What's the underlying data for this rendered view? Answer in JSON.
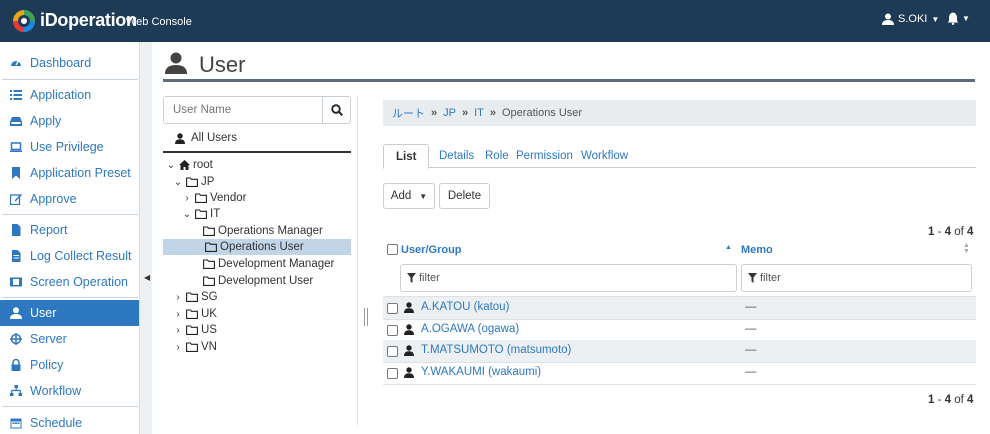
{
  "app": {
    "brand": "iDoperation",
    "brand_sub": "Web Console",
    "username": "S.OKI",
    "colors": {
      "topbar": "#1d3a57",
      "accent": "#2d78c0",
      "selected_tree": "#c2d5e8"
    }
  },
  "sidebar": {
    "items": [
      {
        "label": "Dashboard",
        "icon": "tachometer-icon"
      },
      {
        "label": "Application",
        "icon": "list-icon"
      },
      {
        "label": "Apply",
        "icon": "inbox-icon"
      },
      {
        "label": "Use Privilege",
        "icon": "laptop-icon"
      },
      {
        "label": "Application Preset",
        "icon": "bookmark-icon"
      },
      {
        "label": "Approve",
        "icon": "edit-icon"
      },
      {
        "label": "Report",
        "icon": "file-icon"
      },
      {
        "label": "Log Collect Result",
        "icon": "file-text-icon"
      },
      {
        "label": "Screen Operation",
        "icon": "film-icon"
      },
      {
        "label": "User",
        "icon": "user-icon",
        "active": true
      },
      {
        "label": "Server",
        "icon": "crosshair-icon"
      },
      {
        "label": "Policy",
        "icon": "lock-icon"
      },
      {
        "label": "Workflow",
        "icon": "sitemap-icon"
      },
      {
        "label": "Schedule",
        "icon": "calendar-icon"
      }
    ]
  },
  "page": {
    "title": "User"
  },
  "tree": {
    "search_placeholder": "User Name",
    "all_users": "All Users",
    "nodes": [
      {
        "label": "root",
        "toggle": "v",
        "icon": "home-icon"
      },
      {
        "label": "JP",
        "toggle": "v",
        "icon": "folder-icon"
      },
      {
        "label": "Vendor",
        "toggle": ">",
        "icon": "folder-icon"
      },
      {
        "label": "IT",
        "toggle": "v",
        "icon": "folder-icon"
      },
      {
        "label": "Operations Manager",
        "toggle": "",
        "icon": "folder-icon"
      },
      {
        "label": "Operations User",
        "toggle": "",
        "icon": "folder-icon",
        "selected": true
      },
      {
        "label": "Development Manager",
        "toggle": "",
        "icon": "folder-icon"
      },
      {
        "label": "Development User",
        "toggle": "",
        "icon": "folder-icon"
      },
      {
        "label": "SG",
        "toggle": ">",
        "icon": "folder-icon"
      },
      {
        "label": "UK",
        "toggle": ">",
        "icon": "folder-icon"
      },
      {
        "label": "US",
        "toggle": ">",
        "icon": "folder-icon"
      },
      {
        "label": "VN",
        "toggle": ">",
        "icon": "folder-icon"
      }
    ]
  },
  "breadcrumb": {
    "items": [
      "ルート",
      "JP",
      "IT"
    ],
    "current": "Operations User"
  },
  "tabs": [
    "List",
    "Details",
    "Role",
    "Permission",
    "Workflow"
  ],
  "toolbar": {
    "add_label": "Add",
    "delete_label": "Delete"
  },
  "pager": {
    "from": "1",
    "dash": " - ",
    "to": "4",
    "of": " of ",
    "total": "4"
  },
  "grid": {
    "columns": [
      "User/Group",
      "Memo"
    ],
    "filter_placeholder": "filter",
    "rows": [
      {
        "name": "A.KATOU (katou)",
        "memo": "—"
      },
      {
        "name": "A.OGAWA (ogawa)",
        "memo": "—"
      },
      {
        "name": "T.MATSUMOTO (matsumoto)",
        "memo": "—"
      },
      {
        "name": "Y.WAKAUMI (wakaumi)",
        "memo": "—"
      }
    ]
  }
}
